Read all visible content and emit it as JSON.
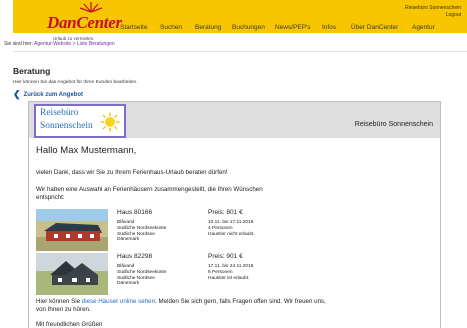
{
  "header": {
    "brand": "DanCenter",
    "tagline": "Urlaub zu vermieten.",
    "nav": [
      "Startseite",
      "Suchen",
      "Beratung",
      "Buchungen",
      "News/PEP's",
      "Infos",
      "Über DanCenter",
      "Agentur"
    ],
    "account_name": "Reisebüro Sonnenschein",
    "logout": "Logout"
  },
  "breadcrumb": {
    "prefix": "Sie sind hier:",
    "path": "Agentur-Website > Liste Beratungen"
  },
  "page": {
    "title": "Beratung",
    "subtitle": "Hier können Sie das Angebot für Ihren Kunden bearbeiten.",
    "back_link": "Zurück zum Angebot"
  },
  "email": {
    "agency_logo_line1": "Reisebüro",
    "agency_logo_line2": "Sonnenschein",
    "agency_name": "Reisebüro Sonnenschein",
    "greeting": "Hallo Max Mustermann,",
    "thanks": "vielen Dank, dass wir Sie zu Ihrem Ferienhaus-Urlaub beraten dürfen!",
    "intro": "Wir haben eine Auswahl an Ferienhäusern zusammengestellt, die Ihren Wünschen entspricht:",
    "houses": [
      {
        "name": "Haus 80166",
        "price": "Preis: 801 €",
        "place": "Blåvand",
        "coast": "Südliche Nordseeküste",
        "region": "Südliche Nordsee",
        "country": "Dänemark",
        "dates": "10.11. bis 17.11.2018",
        "persons": "4 Personen",
        "pets": "Haustier nicht erlaubt."
      },
      {
        "name": "Haus 82298",
        "price": "Preis: 901 €",
        "place": "Blåvand",
        "coast": "Südliche Nordseeküste",
        "region": "Südliche Nordsee",
        "country": "Dänemark",
        "dates": "17.11. bis 24.11.2018",
        "persons": "6 Personen",
        "pets": "Haustier ist erlaubt."
      }
    ],
    "closing_pre": "Hier können Sie ",
    "closing_link": "diese Häuser online sehen",
    "closing_post": ". Melden Sie sich gern, falls Fragen offen sind. Wir freuen uns, von Ihnen zu hören.",
    "signoff": "Mit freundlichen Grüßen"
  },
  "colors": {
    "header_bg": "#f7c600",
    "brand_red": "#c8102e",
    "link_blue": "#2a6fb8",
    "breadcrumb_purple": "#7a2da0"
  }
}
